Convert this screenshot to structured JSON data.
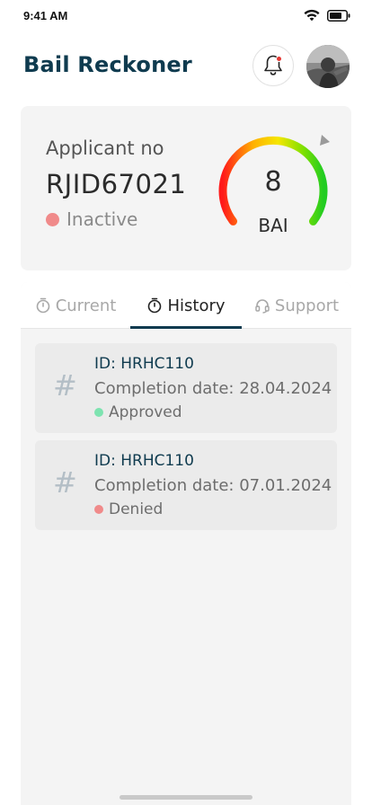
{
  "status_bar": {
    "time": "9:41 AM",
    "icons": [
      "wifi-icon",
      "battery-icon"
    ]
  },
  "header": {
    "title": "Bail Reckoner",
    "notification_icon": "bell-icon",
    "has_unread_notification": true
  },
  "applicant": {
    "label": "Applicant no",
    "id": "RJID67021",
    "status": "Inactive",
    "status_color": "#f08a8a"
  },
  "gauge": {
    "value": "8",
    "label": "BAI",
    "level": 0.8,
    "colors": [
      "#ff1a1a",
      "#ffb000",
      "#f5e600",
      "#7ee000",
      "#22cc22"
    ]
  },
  "tabs": [
    {
      "label": "Current",
      "icon": "stopwatch-icon",
      "active": false
    },
    {
      "label": "History",
      "icon": "stopwatch-icon",
      "active": true
    },
    {
      "label": "Support",
      "icon": "headset-icon",
      "active": false
    }
  ],
  "history": [
    {
      "icon": "#",
      "id_text": "ID: HRHC110",
      "date_text": "Completion date: 28.04.2024",
      "status": "Approved",
      "status_color": "#7de3b0"
    },
    {
      "icon": "#",
      "id_text": "ID: HRHC110",
      "date_text": "Completion date: 07.01.2024",
      "status": "Denied",
      "status_color": "#f08a8a"
    }
  ]
}
